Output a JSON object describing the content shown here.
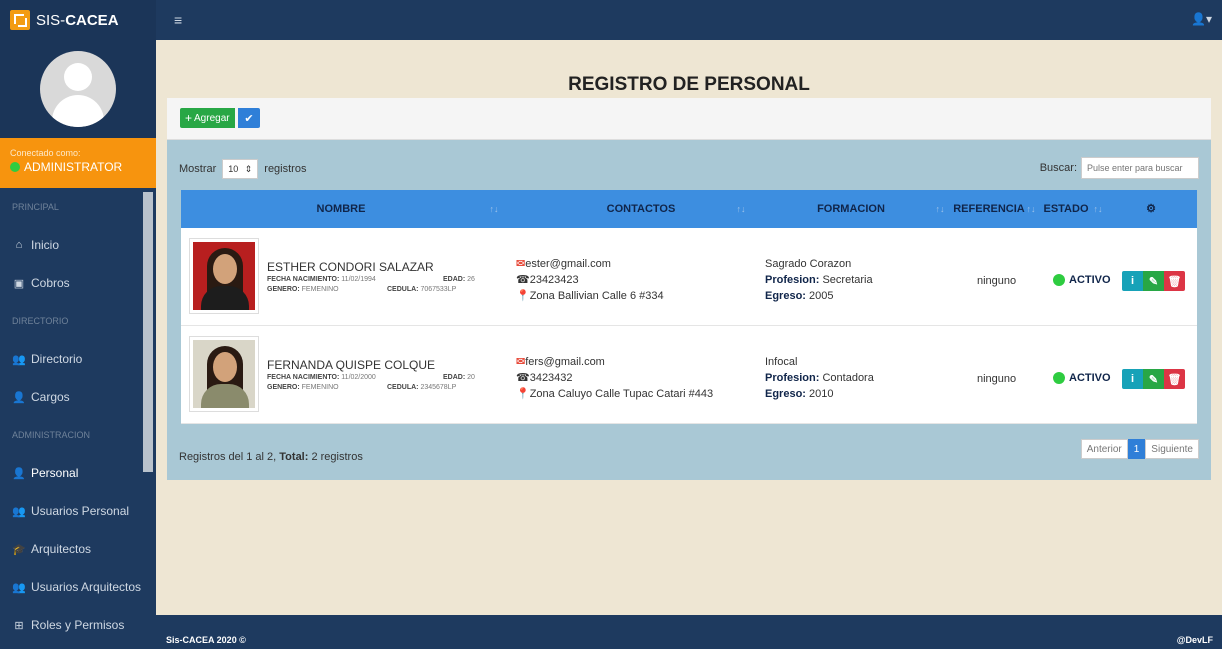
{
  "brand": {
    "prefix": "SIS-",
    "name": "CACEA"
  },
  "sidebar": {
    "connected_label": "Conectado como:",
    "role": "ADMINISTRATOR",
    "sections": {
      "principal": "PRINCIPAL",
      "directorio": "DIRECTORIO",
      "administracion": "ADMINISTRACION"
    },
    "items": {
      "inicio": "Inicio",
      "cobros": "Cobros",
      "directorio": "Directorio",
      "cargos": "Cargos",
      "personal": "Personal",
      "usuarios_personal": "Usuarios Personal",
      "arquitectos": "Arquitectos",
      "usuarios_arquitectos": "Usuarios Arquitectos",
      "roles": "Roles y Permisos"
    }
  },
  "page": {
    "title": "REGISTRO DE PERSONAL"
  },
  "toolbar": {
    "add_label": "Agregar"
  },
  "table_controls": {
    "show_label": "Mostrar",
    "page_size": "10",
    "records_label": "registros",
    "search_label": "Buscar:",
    "search_placeholder": "Pulse enter para buscar"
  },
  "table": {
    "headers": {
      "nombre": "NOMBRE",
      "contactos": "CONTACTOS",
      "formacion": "FORMACION",
      "referencia": "REFERENCIA",
      "estado": "ESTADO"
    },
    "rows": [
      {
        "name": "ESTHER CONDORI SALAZAR",
        "birth_label": "FECHA NACIMIENTO:",
        "birth": "11/02/1994",
        "age_label": "EDAD:",
        "age": "26",
        "gender_label": "GENERO:",
        "gender": "FEMENINO",
        "id_label": "CEDULA:",
        "id": "7067533LP",
        "email": "ester@gmail.com",
        "phone": "23423423",
        "address": "Zona Ballivian Calle 6 #334",
        "institution": "Sagrado Corazon",
        "profession_label": "Profesion:",
        "profession": "Secretaria",
        "egreso_label": "Egreso:",
        "egreso": "2005",
        "reference": "ninguno",
        "status": "ACTIVO"
      },
      {
        "name": "FERNANDA QUISPE COLQUE",
        "birth_label": "FECHA NACIMIENTO:",
        "birth": "11/02/2000",
        "age_label": "EDAD:",
        "age": "20",
        "gender_label": "GENERO:",
        "gender": "FEMENINO",
        "id_label": "CEDULA:",
        "id": "2345678LP",
        "email": "fers@gmail.com",
        "phone": "3423432",
        "address": "Zona Caluyo Calle Tupac Catari #443",
        "institution": "Infocal",
        "profession_label": "Profesion:",
        "profession": "Contadora",
        "egreso_label": "Egreso:",
        "egreso": "2010",
        "reference": "ninguno",
        "status": "ACTIVO"
      }
    ]
  },
  "summary": {
    "prefix": "Registros del 1 al 2,",
    "total_label": "Total:",
    "total": "2 registros"
  },
  "pager": {
    "prev": "Anterior",
    "current": "1",
    "next": "Siguiente"
  },
  "footer": {
    "left": "Sis-CACEA 2020 ©",
    "right": "@DevLF"
  },
  "colors": {
    "sidebar": "#1e3a5f",
    "accent": "#f7940e",
    "table_header": "#3d8ee0",
    "panel": "#a9c8d5",
    "background": "#eee6d3"
  }
}
